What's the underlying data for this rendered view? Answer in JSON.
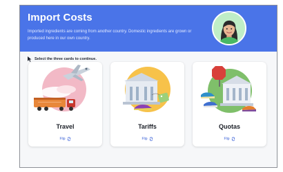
{
  "header": {
    "title": "Import Costs",
    "subtitle": "Imported ingredients are coming from another country. Domestic ingredients are grown or produced here in our own country."
  },
  "instruction": "Select the three cards to continue.",
  "cards": [
    {
      "label": "Travel",
      "flip_label": "Flip"
    },
    {
      "label": "Tariffs",
      "flip_label": "Flip"
    },
    {
      "label": "Quotas",
      "flip_label": "Flip"
    }
  ],
  "colors": {
    "header_bg": "#4a74e8",
    "accent": "#3d64d8",
    "travel_circle": "#f2b9c6",
    "tariffs_circle": "#f7c24a",
    "quotas_circle": "#7fbf6a"
  },
  "icons": [
    "cursor-icon",
    "avatar",
    "flip-icon"
  ]
}
